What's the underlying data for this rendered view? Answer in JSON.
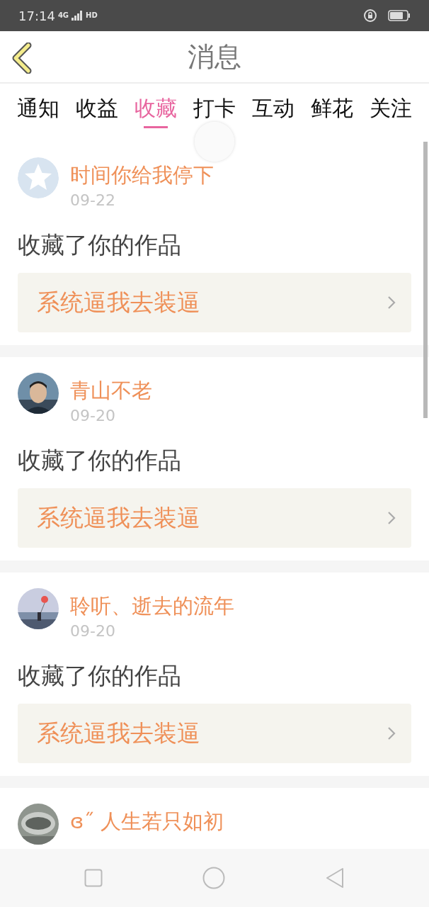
{
  "status_bar": {
    "time": "17:14",
    "network": "4G",
    "hd": "HD"
  },
  "header": {
    "title": "消息"
  },
  "tabs": [
    {
      "label": "通知",
      "selected": false
    },
    {
      "label": "收益",
      "selected": false
    },
    {
      "label": "收藏",
      "selected": true
    },
    {
      "label": "打卡",
      "selected": false
    },
    {
      "label": "互动",
      "selected": false
    },
    {
      "label": "鲜花",
      "selected": false
    },
    {
      "label": "关注",
      "selected": false
    }
  ],
  "messages": [
    {
      "avatar": {
        "kind": "star"
      },
      "name": "时间你给我停下",
      "date": "09-22",
      "action": "收藏了你的作品",
      "link": "系统逼我去装逼"
    },
    {
      "name": "青山不老",
      "date": "09-20",
      "action": "收藏了你的作品",
      "link": "系统逼我去装逼"
    },
    {
      "name": "聆听、逝去的流年",
      "date": "09-20",
      "action": "收藏了你的作品",
      "link": "系统逼我去装逼"
    },
    {
      "name": "ɞ˝  人生若只如初"
    }
  ]
}
